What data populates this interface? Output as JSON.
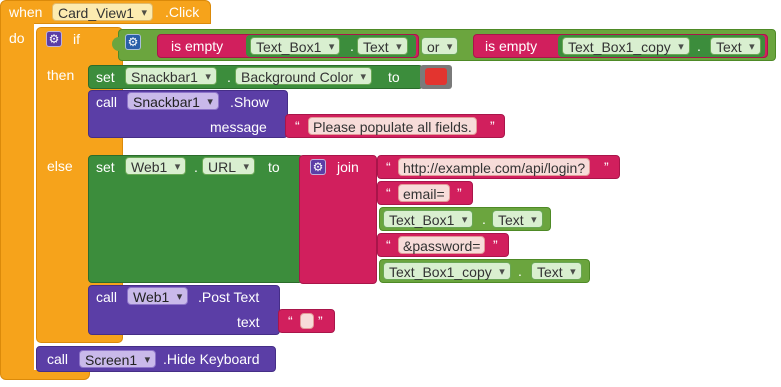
{
  "colors": {
    "control": "#f6a31b",
    "control_dark": "#db8a0a",
    "component_setget": "#3c8d3c",
    "component_method": "#5b3ea6",
    "text": "#d11f5d",
    "logic": "#6ba53e",
    "color_red": "#e3342f"
  },
  "event": {
    "when": "when",
    "component": "Card_View1",
    "event": ".Click",
    "do": "do"
  },
  "if_block": {
    "if": "if",
    "is_empty_1": "is empty",
    "cond1_component": "Text_Box1",
    "cond1_property": "Text",
    "or": "or",
    "is_empty_2": "is empty",
    "cond2_component": "Text_Box1_copy",
    "cond2_property": "Text",
    "then": "then",
    "else": "else"
  },
  "then_branch": {
    "set": "set",
    "component": "Snackbar1",
    "property": "Background Color",
    "to": "to",
    "call": "call",
    "call_component": "Snackbar1",
    "method": ".Show",
    "message_label": "message",
    "message_value": "Please populate all fields."
  },
  "else_branch": {
    "set": "set",
    "component": "Web1",
    "property": "URL",
    "to": "to",
    "join": "join",
    "join_items": [
      "http://example.com/api/login?",
      "email=",
      "&password="
    ],
    "getter1_component": "Text_Box1",
    "getter1_property": "Text",
    "getter2_component": "Text_Box1_copy",
    "getter2_property": "Text",
    "call": "call",
    "call_component": "Web1",
    "method": ".Post Text",
    "text_label": "text",
    "text_value": ""
  },
  "final_call": {
    "call": "call",
    "component": "Screen1",
    "method": ".Hide Keyboard"
  },
  "quote_open": "“",
  "quote_close": "”",
  "icons": {
    "mutator": "gear-icon"
  }
}
